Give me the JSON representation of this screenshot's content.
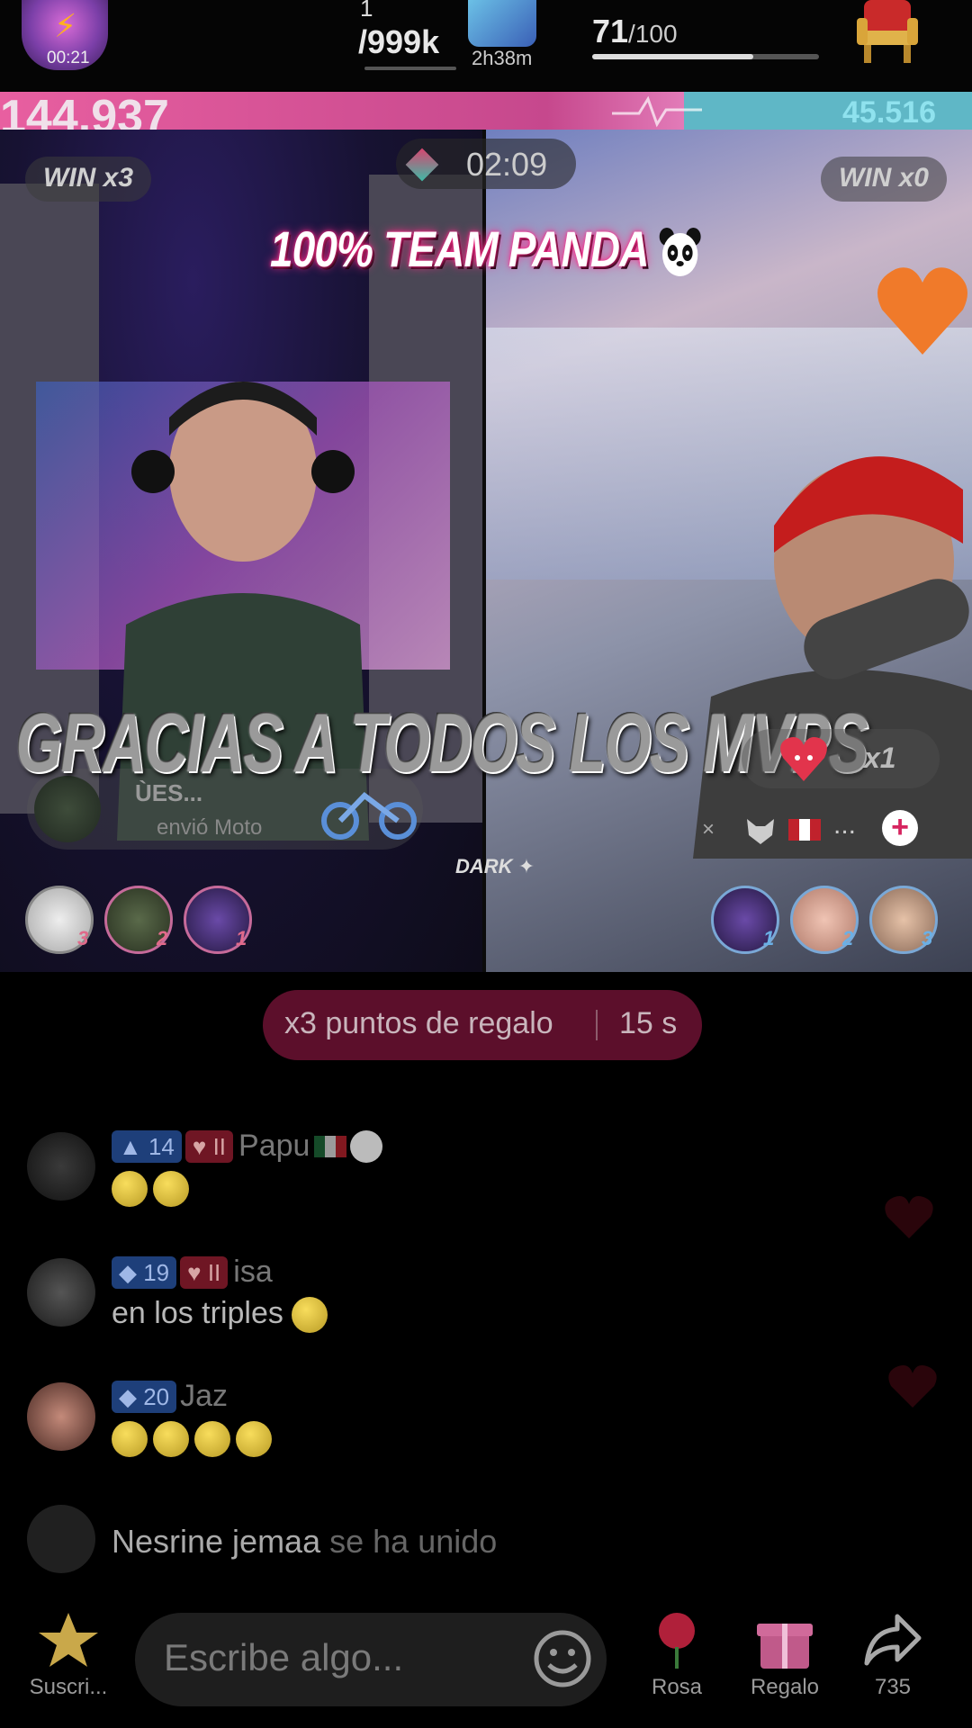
{
  "top": {
    "live_timer": "00:21",
    "rank_current": "1",
    "rank_total": "/999k",
    "live_duration": "2h38m",
    "progress_value": "71",
    "progress_max": "/100",
    "progress_fraction": 0.71
  },
  "battle": {
    "score_left": "144.937",
    "score_right": "45.516",
    "win_left": "WIN x3",
    "win_right": "WIN x0",
    "countdown": "02:09",
    "overlay_title": "100% TEAM PANDA",
    "overlay_caption": "GRACIAS A TODOS LOS MVPS",
    "gift_sender": "ÙES...",
    "gift_text": "envió  Moto",
    "overlay_tag": "DARK",
    "heart_multiplier": "x1",
    "mvp_left_ranks": [
      "3",
      "2",
      "1"
    ],
    "mvp_right_ranks": [
      "1",
      "2",
      "3"
    ],
    "more_dots": "...",
    "mute_x": "×"
  },
  "gift_points": {
    "text": "x3 puntos de regalo",
    "seconds": "15 s"
  },
  "comments": [
    {
      "level": "14",
      "fan": "II",
      "user": "Papu",
      "message": ""
    },
    {
      "level": "19",
      "fan": "II",
      "user": "isa",
      "message": "en los triples"
    },
    {
      "level": "20",
      "fan": "",
      "user": "Jaz",
      "message": ""
    }
  ],
  "joined": {
    "user": "Nesrine jemaa",
    "text": "se ha unido"
  },
  "bottom": {
    "subscribe_label": "Suscri...",
    "input_placeholder": "Escribe algo...",
    "rose_label": "Rosa",
    "gift_label": "Regalo",
    "share_count": "735"
  },
  "colors": {
    "score_left": "#e85fa0",
    "score_right": "#5fb7c6",
    "points_pill": "#5c0f2b",
    "accent": "#d6245f"
  },
  "icons": [
    "bolt-icon",
    "tiktok-live-icon",
    "throne-icon",
    "panda-icon",
    "heart-icon",
    "wolf-icon",
    "peru-flag-icon",
    "plus-icon",
    "wave-hand-icon",
    "star-icon",
    "smile-icon",
    "rose-icon",
    "gift-icon",
    "share-icon"
  ]
}
